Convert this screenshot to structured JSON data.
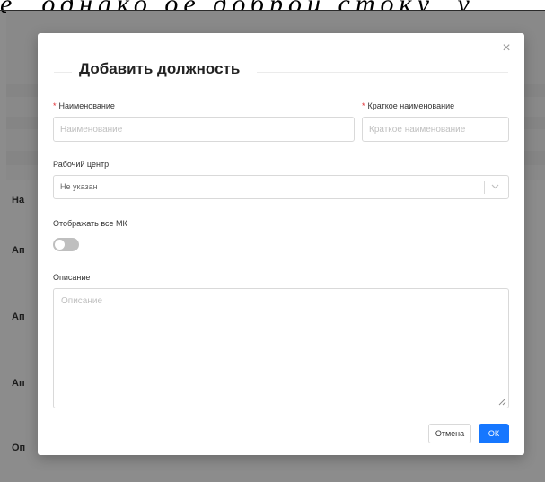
{
  "background": {
    "header_text": "е, однако ое доброй стоку, у",
    "row_labels": [
      "На",
      "Ап",
      "Ап",
      "Ап",
      "Оп"
    ]
  },
  "modal": {
    "title": "Добавить должность",
    "close_glyph": "×",
    "name_field": {
      "label": "Наименование",
      "required_mark": "*",
      "placeholder": "Наименование"
    },
    "short_name_field": {
      "label": "Краткое наименование",
      "required_mark": "*",
      "placeholder": "Краткое наименование"
    },
    "work_center": {
      "label": "Рабочий центр",
      "value": "Не указан"
    },
    "show_all_mk": {
      "label": "Отображать все МК",
      "enabled": false
    },
    "description": {
      "label": "Описание",
      "placeholder": "Описание"
    },
    "buttons": {
      "cancel": "Отмена",
      "ok": "ОК"
    }
  },
  "colors": {
    "primary": "#1677ff",
    "required": "#e0282e",
    "toggle_off": "#bfbfbf"
  }
}
